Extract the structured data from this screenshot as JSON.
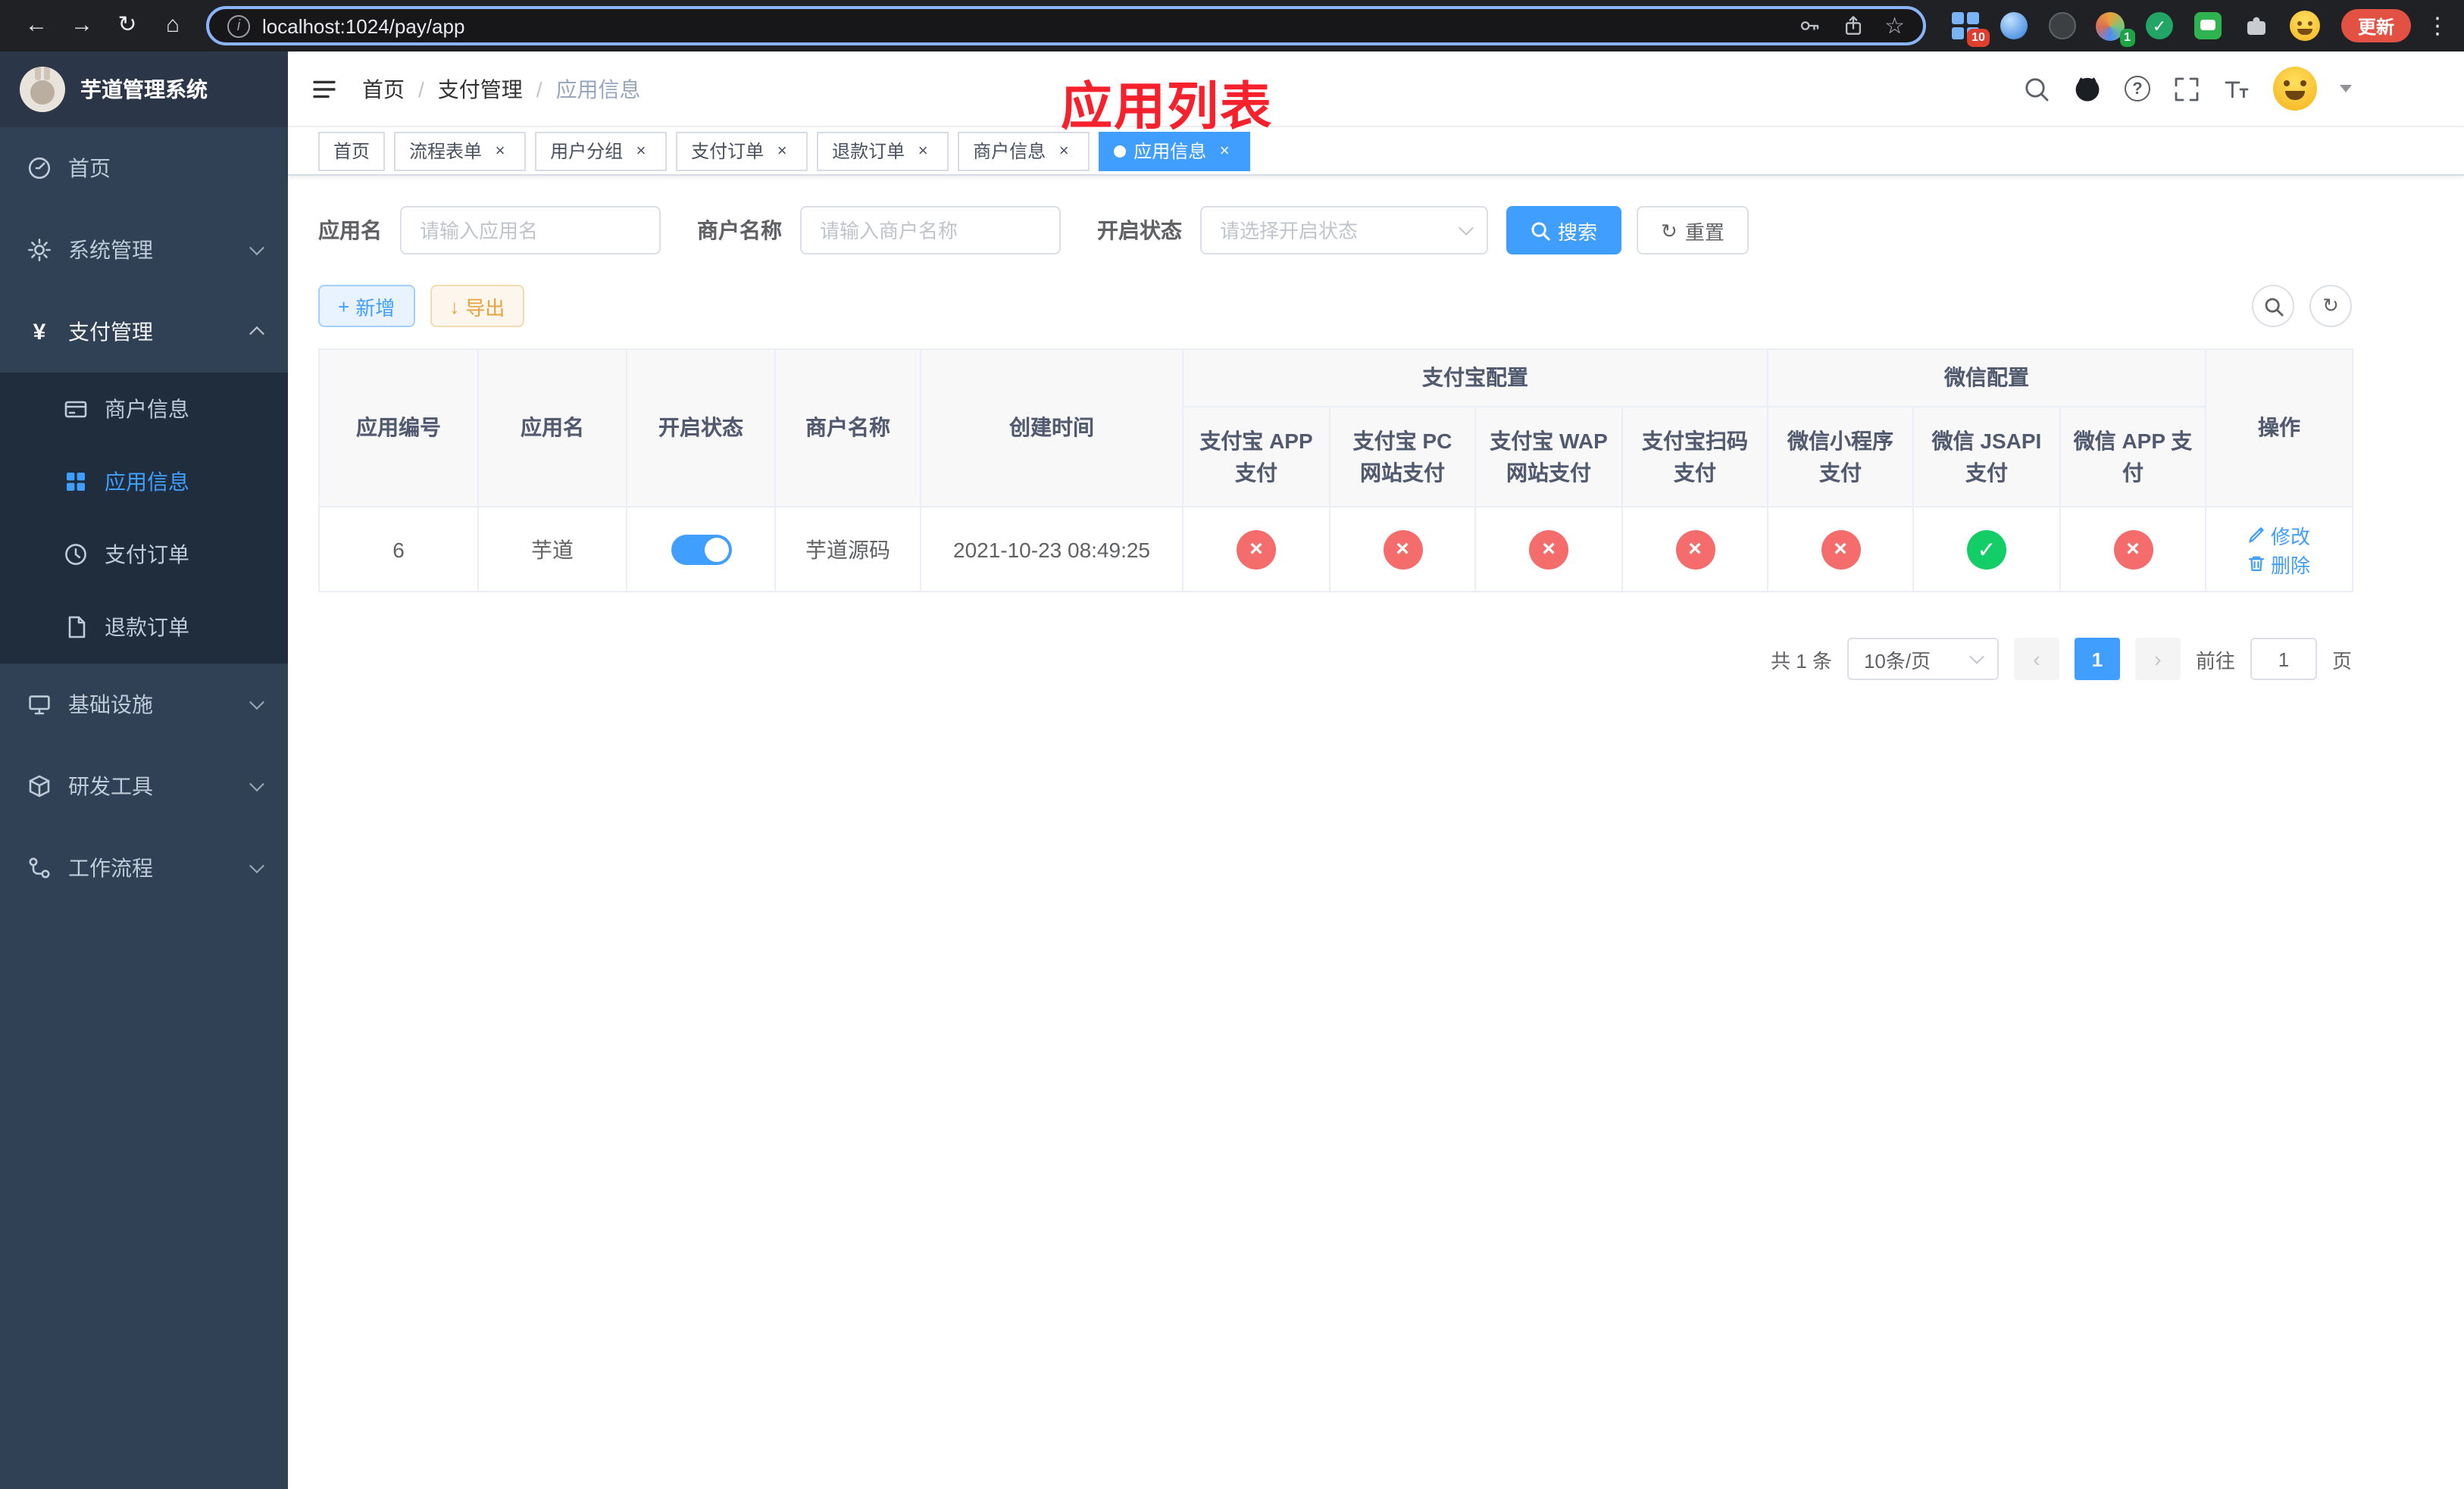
{
  "colors": {
    "primary": "#409eff",
    "success": "#13ce66",
    "danger": "#f56c6c",
    "warning": "#e6a23c",
    "sidebar_bg": "#304156",
    "annotation_red": "#f5222d"
  },
  "icons": {
    "back": "←",
    "forward": "→",
    "reload": "↻",
    "home": "⌂",
    "info": "i",
    "star": "☆",
    "kebab": "⋮",
    "close": "×",
    "check": "✓",
    "plus": "+",
    "download": "↓",
    "refresh": "↻",
    "prev": "‹",
    "next": "›",
    "question": "?",
    "slash": "/",
    "yen": "¥"
  },
  "browser": {
    "url": "localhost:1024/pay/app",
    "update_label": "更新",
    "extension_badge": "10",
    "profile_badge": "1"
  },
  "sidebar": {
    "title": "芋道管理系统",
    "items": {
      "home": "首页",
      "system": "系统管理",
      "pay": "支付管理",
      "merchant": "商户信息",
      "app": "应用信息",
      "order": "支付订单",
      "refund": "退款订单",
      "infra": "基础设施",
      "devtool": "研发工具",
      "workflow": "工作流程"
    }
  },
  "navbar": {
    "breadcrumb": {
      "home": "首页",
      "pay": "支付管理",
      "app": "应用信息"
    },
    "overlay_title": "应用列表"
  },
  "tabs": {
    "t0": "首页",
    "t1": "流程表单",
    "t2": "用户分组",
    "t3": "支付订单",
    "t4": "退款订单",
    "t5": "商户信息",
    "t6": "应用信息"
  },
  "filters": {
    "app_name_label": "应用名",
    "app_name_placeholder": "请输入应用名",
    "merchant_label": "商户名称",
    "merchant_placeholder": "请输入商户名称",
    "status_label": "开启状态",
    "status_placeholder": "请选择开启状态",
    "search": "搜索",
    "reset": "重置"
  },
  "toolbar": {
    "add": "新增",
    "export": "导出"
  },
  "table": {
    "group_alipay": "支付宝配置",
    "group_wechat": "微信配置",
    "col_app_id": "应用编号",
    "col_app_name": "应用名",
    "col_status": "开启状态",
    "col_merchant": "商户名称",
    "col_created": "创建时间",
    "col_alipay_app": "支付宝 APP 支付",
    "col_alipay_pc": "支付宝 PC 网站支付",
    "col_alipay_wap": "支付宝 WAP 网站支付",
    "col_alipay_qr": "支付宝扫码支付",
    "col_wx_mini": "微信小程序支付",
    "col_wx_jsapi": "微信 JSAPI 支付",
    "col_wx_app": "微信 APP 支付",
    "col_actions": "操作",
    "rows": [
      {
        "app_id": "6",
        "app_name": "芋道",
        "status": "on",
        "merchant": "芋道源码",
        "created": "2021-10-23 08:49:25",
        "alipay_app": "disabled",
        "alipay_pc": "disabled",
        "alipay_wap": "disabled",
        "alipay_qr": "disabled",
        "wx_mini": "disabled",
        "wx_jsapi": "enabled",
        "wx_app": "disabled",
        "edit": "修改",
        "delete": "删除"
      }
    ]
  },
  "pagination": {
    "total": "共 1 条",
    "page_size": "10条/页",
    "page": "1",
    "goto_label": "前往",
    "goto_value": "1",
    "page_unit": "页"
  }
}
